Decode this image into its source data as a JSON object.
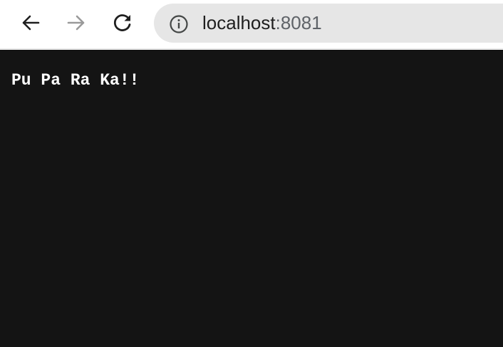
{
  "browser": {
    "back_icon": "arrow-left-icon",
    "forward_icon": "arrow-right-icon",
    "reload_icon": "reload-icon",
    "site_info_icon": "info-icon",
    "address": {
      "host": "localhost",
      "port": ":8081"
    }
  },
  "page": {
    "text": "Pu Pa Ra Ka!!",
    "background": "#141414",
    "text_color": "#ffffff"
  }
}
